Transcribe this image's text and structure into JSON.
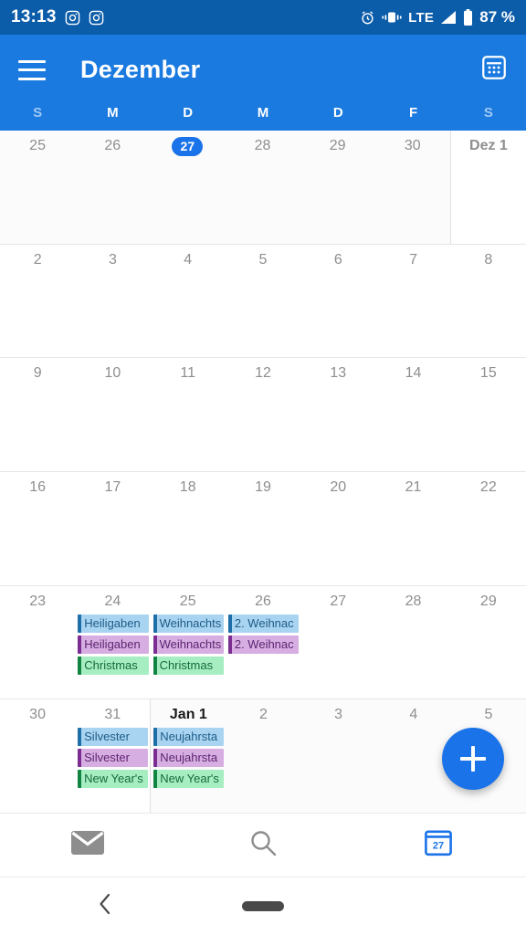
{
  "statusbar": {
    "time": "13:13",
    "notification_icons": [
      "camera-icon",
      "camera-icon"
    ],
    "alarm_icon": "alarm-clock-icon",
    "vibrate_icon": "vibrate-icon",
    "network": "LTE",
    "signal_icon": "signal-bars-icon",
    "battery_icon": "battery-icon",
    "battery_percent": "87 %"
  },
  "appbar": {
    "menu_icon": "hamburger-menu-icon",
    "title": "Dezember",
    "action_icon": "calendar-grid-icon"
  },
  "weekdays": [
    {
      "label": "S",
      "weekend": true
    },
    {
      "label": "M",
      "weekend": false
    },
    {
      "label": "D",
      "weekend": false
    },
    {
      "label": "M",
      "weekend": false
    },
    {
      "label": "D",
      "weekend": false
    },
    {
      "label": "F",
      "weekend": false
    },
    {
      "label": "S",
      "weekend": true
    }
  ],
  "weeks": [
    [
      {
        "num": "25",
        "in_month": false,
        "today": false,
        "first_of_month": false,
        "month_start": false,
        "events": []
      },
      {
        "num": "26",
        "in_month": false,
        "today": false,
        "first_of_month": false,
        "month_start": false,
        "events": []
      },
      {
        "num": "27",
        "in_month": false,
        "today": true,
        "first_of_month": false,
        "month_start": false,
        "events": []
      },
      {
        "num": "28",
        "in_month": false,
        "today": false,
        "first_of_month": false,
        "month_start": false,
        "events": []
      },
      {
        "num": "29",
        "in_month": false,
        "today": false,
        "first_of_month": false,
        "month_start": false,
        "events": []
      },
      {
        "num": "30",
        "in_month": false,
        "today": false,
        "first_of_month": false,
        "month_start": false,
        "events": []
      },
      {
        "num": "Dez 1",
        "in_month": true,
        "today": false,
        "first_of_month": true,
        "month_start": true,
        "events": []
      }
    ],
    [
      {
        "num": "2",
        "in_month": true,
        "today": false,
        "first_of_month": false,
        "month_start": false,
        "events": []
      },
      {
        "num": "3",
        "in_month": true,
        "today": false,
        "first_of_month": false,
        "month_start": false,
        "events": []
      },
      {
        "num": "4",
        "in_month": true,
        "today": false,
        "first_of_month": false,
        "month_start": false,
        "events": []
      },
      {
        "num": "5",
        "in_month": true,
        "today": false,
        "first_of_month": false,
        "month_start": false,
        "events": []
      },
      {
        "num": "6",
        "in_month": true,
        "today": false,
        "first_of_month": false,
        "month_start": false,
        "events": []
      },
      {
        "num": "7",
        "in_month": true,
        "today": false,
        "first_of_month": false,
        "month_start": false,
        "events": []
      },
      {
        "num": "8",
        "in_month": true,
        "today": false,
        "first_of_month": false,
        "month_start": false,
        "events": []
      }
    ],
    [
      {
        "num": "9",
        "in_month": true,
        "today": false,
        "first_of_month": false,
        "month_start": false,
        "events": []
      },
      {
        "num": "10",
        "in_month": true,
        "today": false,
        "first_of_month": false,
        "month_start": false,
        "events": []
      },
      {
        "num": "11",
        "in_month": true,
        "today": false,
        "first_of_month": false,
        "month_start": false,
        "events": []
      },
      {
        "num": "12",
        "in_month": true,
        "today": false,
        "first_of_month": false,
        "month_start": false,
        "events": []
      },
      {
        "num": "13",
        "in_month": true,
        "today": false,
        "first_of_month": false,
        "month_start": false,
        "events": []
      },
      {
        "num": "14",
        "in_month": true,
        "today": false,
        "first_of_month": false,
        "month_start": false,
        "events": []
      },
      {
        "num": "15",
        "in_month": true,
        "today": false,
        "first_of_month": false,
        "month_start": false,
        "events": []
      }
    ],
    [
      {
        "num": "16",
        "in_month": true,
        "today": false,
        "first_of_month": false,
        "month_start": false,
        "events": []
      },
      {
        "num": "17",
        "in_month": true,
        "today": false,
        "first_of_month": false,
        "month_start": false,
        "events": []
      },
      {
        "num": "18",
        "in_month": true,
        "today": false,
        "first_of_month": false,
        "month_start": false,
        "events": []
      },
      {
        "num": "19",
        "in_month": true,
        "today": false,
        "first_of_month": false,
        "month_start": false,
        "events": []
      },
      {
        "num": "20",
        "in_month": true,
        "today": false,
        "first_of_month": false,
        "month_start": false,
        "events": []
      },
      {
        "num": "21",
        "in_month": true,
        "today": false,
        "first_of_month": false,
        "month_start": false,
        "events": []
      },
      {
        "num": "22",
        "in_month": true,
        "today": false,
        "first_of_month": false,
        "month_start": false,
        "events": []
      }
    ],
    [
      {
        "num": "23",
        "in_month": true,
        "today": false,
        "first_of_month": false,
        "month_start": false,
        "events": []
      },
      {
        "num": "24",
        "in_month": true,
        "today": false,
        "first_of_month": false,
        "month_start": false,
        "events": [
          {
            "label": "Heiligaben",
            "color": "blue"
          },
          {
            "label": "Heiligaben",
            "color": "purple"
          },
          {
            "label": "Christmas",
            "color": "green"
          }
        ]
      },
      {
        "num": "25",
        "in_month": true,
        "today": false,
        "first_of_month": false,
        "month_start": false,
        "events": [
          {
            "label": "Weihnachts",
            "color": "blue"
          },
          {
            "label": "Weihnachts",
            "color": "purple"
          },
          {
            "label": "Christmas",
            "color": "green"
          }
        ]
      },
      {
        "num": "26",
        "in_month": true,
        "today": false,
        "first_of_month": false,
        "month_start": false,
        "events": [
          {
            "label": "2. Weihnac",
            "color": "blue"
          },
          {
            "label": "2. Weihnac",
            "color": "purple"
          }
        ]
      },
      {
        "num": "27",
        "in_month": true,
        "today": false,
        "first_of_month": false,
        "month_start": false,
        "events": []
      },
      {
        "num": "28",
        "in_month": true,
        "today": false,
        "first_of_month": false,
        "month_start": false,
        "events": []
      },
      {
        "num": "29",
        "in_month": true,
        "today": false,
        "first_of_month": false,
        "month_start": false,
        "events": []
      }
    ],
    [
      {
        "num": "30",
        "in_month": true,
        "today": false,
        "first_of_month": false,
        "month_start": false,
        "events": []
      },
      {
        "num": "31",
        "in_month": true,
        "today": false,
        "first_of_month": false,
        "month_start": false,
        "events": [
          {
            "label": "Silvester",
            "color": "blue"
          },
          {
            "label": "Silvester",
            "color": "purple"
          },
          {
            "label": "New Year's",
            "color": "green"
          }
        ]
      },
      {
        "num": "Jan 1",
        "in_month": false,
        "today": false,
        "first_of_month": true,
        "month_start": true,
        "events": [
          {
            "label": "Neujahrsta",
            "color": "blue"
          },
          {
            "label": "Neujahrsta",
            "color": "purple"
          },
          {
            "label": "New Year's",
            "color": "green"
          }
        ]
      },
      {
        "num": "2",
        "in_month": false,
        "today": false,
        "first_of_month": false,
        "month_start": false,
        "events": []
      },
      {
        "num": "3",
        "in_month": false,
        "today": false,
        "first_of_month": false,
        "month_start": false,
        "events": []
      },
      {
        "num": "4",
        "in_month": false,
        "today": false,
        "first_of_month": false,
        "month_start": false,
        "events": []
      },
      {
        "num": "5",
        "in_month": false,
        "today": false,
        "first_of_month": false,
        "month_start": false,
        "events": []
      }
    ]
  ],
  "fab": {
    "icon": "plus-icon"
  },
  "bottomnav": [
    {
      "icon": "mail-icon",
      "active": false
    },
    {
      "icon": "search-icon",
      "active": false
    },
    {
      "icon": "calendar-icon",
      "active": true,
      "badge": "27"
    }
  ],
  "sysnav": {
    "back_icon": "back-chevron-icon",
    "home_icon": "home-pill-icon"
  },
  "colors": {
    "statusbar_bg": "#0b5ca9",
    "appbar_bg": "#1a7ae0",
    "accent": "#1a73e8",
    "chip_blue_bg": "#a9d4f1",
    "chip_purple_bg": "#d6aee2",
    "chip_green_bg": "#a6eec2"
  }
}
